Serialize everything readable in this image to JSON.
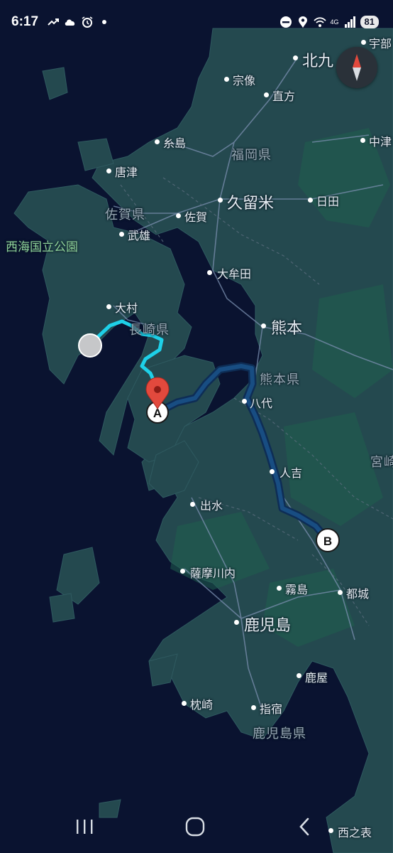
{
  "status_bar": {
    "time": "6:17",
    "battery": "81",
    "network": "4G",
    "left_icons": [
      "trending-icon",
      "cloud-icon",
      "alarm-icon",
      "dot-icon"
    ],
    "right_icons": [
      "dnd-icon",
      "location-icon",
      "wifi-icon",
      "signal-icon",
      "battery-icon"
    ]
  },
  "map": {
    "labels": {
      "kitakyushu": "北九",
      "munakata": "宗像",
      "nogata": "直方",
      "ube": "宇部",
      "itoshima": "糸島",
      "fukuoka_pref": "福岡県",
      "nakatsu": "中津",
      "karatsu": "唐津",
      "saga_pref": "佐賀県",
      "kurume": "久留米",
      "hita": "日田",
      "saga": "佐賀",
      "takeo": "武雄",
      "saikai_park": "西海国立公園",
      "omuta": "大牟田",
      "omura": "大村",
      "nagasaki_pref": "長崎県",
      "kumamoto": "熊本",
      "kumamoto_pref": "熊本県",
      "yatsushiro": "八代",
      "miyazaki": "宮崎",
      "hitoyoshi": "人吉",
      "izumi": "出水",
      "satsumasendai": "薩摩川内",
      "kirishima": "霧島",
      "miyakonojo": "都城",
      "kagoshima": "鹿児島",
      "kanoya": "鹿屋",
      "makurazaki": "枕崎",
      "ibusuki": "指宿",
      "kagoshima_pref": "鹿児島県",
      "nishinoomote": "西之表"
    },
    "markers": {
      "start": "A",
      "end": "B"
    },
    "colors": {
      "water": "#0a1330",
      "land": "#24494f",
      "route_active": "#1ed0e8",
      "route_main": "#184d82",
      "pin": "#e2493d"
    }
  },
  "navbar": {
    "buttons": [
      "recents-button",
      "home-button",
      "back-button"
    ]
  }
}
